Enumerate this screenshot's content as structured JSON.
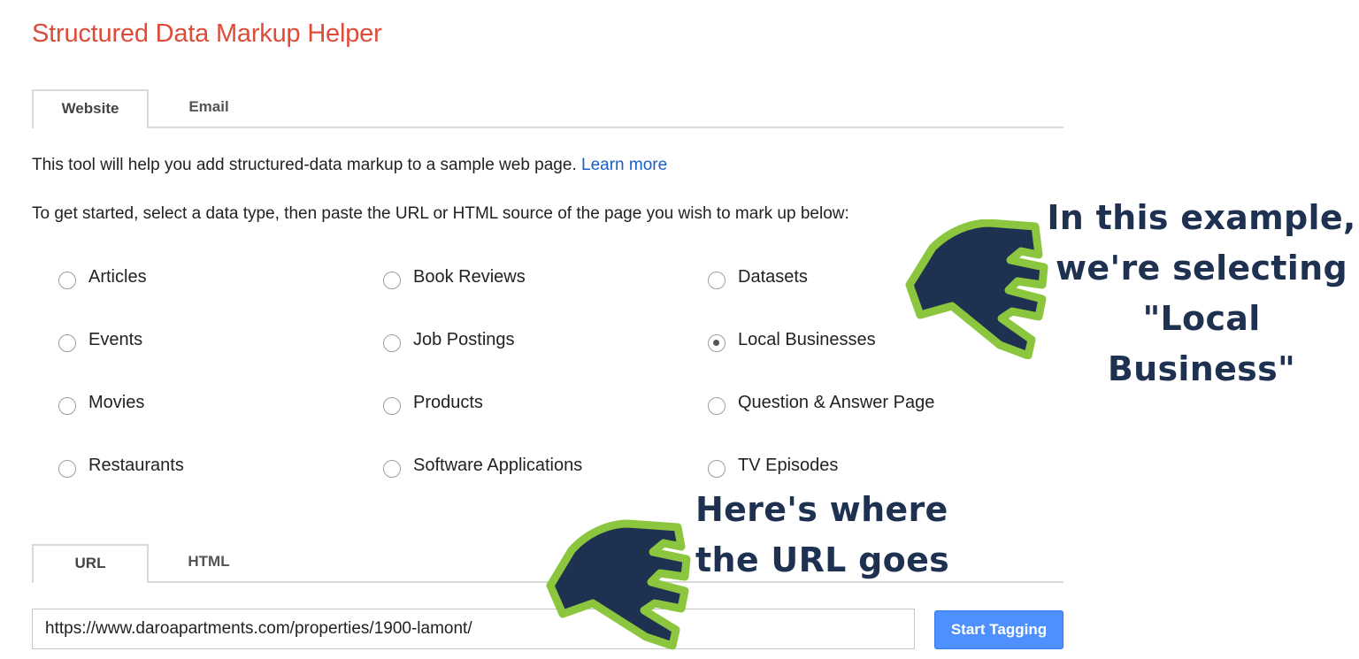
{
  "app": {
    "title": "Structured Data Markup Helper"
  },
  "source_tabs": [
    {
      "label": "Website",
      "active": true
    },
    {
      "label": "Email",
      "active": false
    }
  ],
  "intro": {
    "text": "This tool will help you add structured-data markup to a sample web page.",
    "learn_more": "Learn more"
  },
  "prompt": "To get started, select a data type, then paste the URL or HTML source of the page you wish to mark up below:",
  "data_types": [
    {
      "label": "Articles",
      "checked": false
    },
    {
      "label": "Book Reviews",
      "checked": false
    },
    {
      "label": "Datasets",
      "checked": false
    },
    {
      "label": "Events",
      "checked": false
    },
    {
      "label": "Job Postings",
      "checked": false
    },
    {
      "label": "Local Businesses",
      "checked": true
    },
    {
      "label": "Movies",
      "checked": false
    },
    {
      "label": "Products",
      "checked": false
    },
    {
      "label": "Question & Answer Page",
      "checked": false
    },
    {
      "label": "Restaurants",
      "checked": false
    },
    {
      "label": "Software Applications",
      "checked": false
    },
    {
      "label": "TV Episodes",
      "checked": false
    }
  ],
  "input_tabs": [
    {
      "label": "URL",
      "active": true
    },
    {
      "label": "HTML",
      "active": false
    }
  ],
  "url_field": {
    "value": "https://www.daroapartments.com/properties/1900-lamont/"
  },
  "start_button": {
    "label": "Start Tagging"
  },
  "annotations": {
    "callout_one": {
      "line1": "In this example,",
      "line2": "we're selecting",
      "line3": "\"Local Business\""
    },
    "callout_two": {
      "line1": "Here's where",
      "line2": "the URL goes"
    }
  },
  "colors": {
    "title": "#dd4b39",
    "link": "#1a5fc7",
    "button": "#4d90fe",
    "callout_text": "#1f3150",
    "hand_fill": "#1f3150",
    "hand_outline": "#8cc63f"
  }
}
